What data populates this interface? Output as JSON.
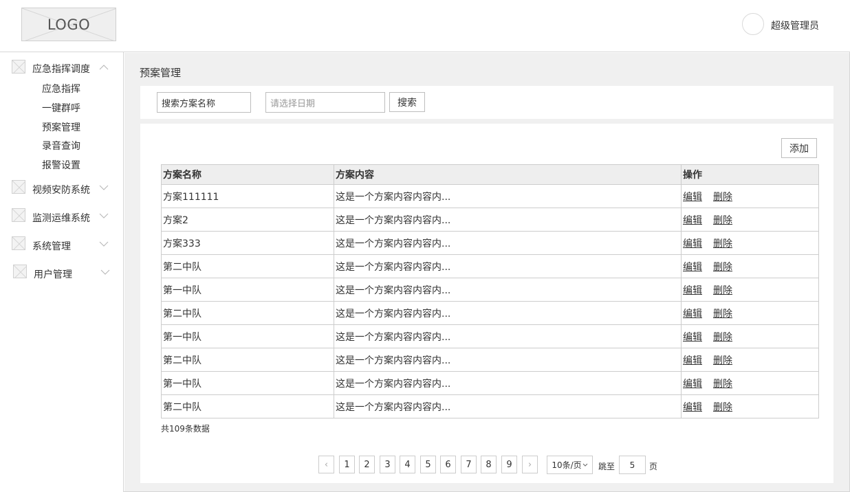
{
  "header": {
    "logo_text": "LOGO",
    "username": "超级管理员"
  },
  "sidebar": {
    "groups": [
      {
        "label": "应急指挥调度",
        "expanded": true,
        "children": [
          "应急指挥",
          "一键群呼",
          "预案管理",
          "录音查询",
          "报警设置"
        ]
      },
      {
        "label": "视频安防系统",
        "expanded": false
      },
      {
        "label": "监测运维系统",
        "expanded": false
      },
      {
        "label": "系统管理",
        "expanded": false
      },
      {
        "label": "用户管理",
        "expanded": false
      }
    ]
  },
  "main": {
    "page_title": "预案管理",
    "search": {
      "name_value": "搜索方案名称",
      "date_placeholder": "请选择日期",
      "search_button": "搜索"
    },
    "add_button": "添加",
    "table": {
      "columns": [
        "方案名称",
        "方案内容",
        "操作"
      ],
      "edit_label": "编辑",
      "delete_label": "删除",
      "rows": [
        {
          "name": "方案111111",
          "content": "这是一个方案内容内容内..."
        },
        {
          "name": "方案2",
          "content": "这是一个方案内容内容内..."
        },
        {
          "name": "方案333",
          "content": "这是一个方案内容内容内..."
        },
        {
          "name": "第二中队",
          "content": "这是一个方案内容内容内..."
        },
        {
          "name": "第一中队",
          "content": "这是一个方案内容内容内..."
        },
        {
          "name": "第二中队",
          "content": "这是一个方案内容内容内..."
        },
        {
          "name": "第一中队",
          "content": "这是一个方案内容内容内..."
        },
        {
          "name": "第二中队",
          "content": "这是一个方案内容内容内..."
        },
        {
          "name": "第一中队",
          "content": "这是一个方案内容内容内..."
        },
        {
          "name": "第二中队",
          "content": "这是一个方案内容内容内..."
        }
      ]
    },
    "total_text": "共109条数据",
    "pagination": {
      "prev": "‹",
      "next": "›",
      "pages": [
        "1",
        "2",
        "3",
        "4",
        "5",
        "6",
        "7",
        "8",
        "9"
      ],
      "current_page": "1",
      "page_size": "10条/页",
      "jump_label": "跳至",
      "jump_value": "5",
      "page_suffix": "页"
    }
  },
  "icons": {
    "collapse": "chevron-up-icon",
    "expand": "chevron-down-icon",
    "menu": "image-placeholder-icon"
  }
}
